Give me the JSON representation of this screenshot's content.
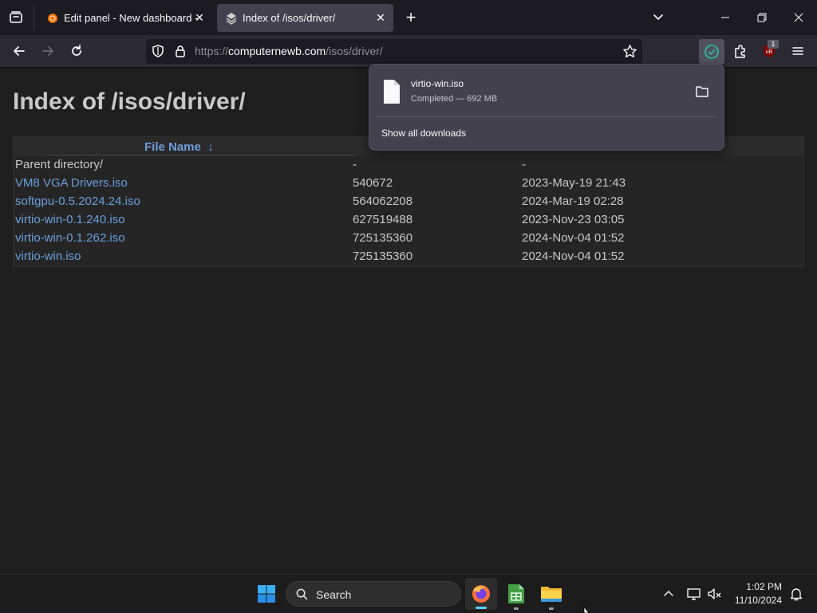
{
  "browser": {
    "tabs": [
      {
        "title": "Edit panel - New dashboard - D",
        "active": false
      },
      {
        "title": "Index of /isos/driver/",
        "active": true
      }
    ],
    "url": {
      "host_prefix": "https://",
      "host": "computernewb.com",
      "path": "/isos/driver/"
    },
    "badge_count": "1",
    "colors": {
      "accent": "#2ac3a2",
      "link": "#6a9fdc",
      "toolbar": "#2b2a33"
    }
  },
  "page": {
    "title": "Index of /isos/driver/",
    "header": {
      "file_name": "File Name",
      "sort_indicator": "↓"
    },
    "rows": [
      {
        "name": "Parent directory/",
        "size": "-",
        "date": "-",
        "link": false
      },
      {
        "name": "VM8 VGA Drivers.iso",
        "size": "540672",
        "date": "2023-May-19 21:43",
        "link": true
      },
      {
        "name": "softgpu-0.5.2024.24.iso",
        "size": "564062208",
        "date": "2024-Mar-19 02:28",
        "link": true
      },
      {
        "name": "virtio-win-0.1.240.iso",
        "size": "627519488",
        "date": "2023-Nov-23 03:05",
        "link": true
      },
      {
        "name": "virtio-win-0.1.262.iso",
        "size": "725135360",
        "date": "2024-Nov-04 01:52",
        "link": true
      },
      {
        "name": "virtio-win.iso",
        "size": "725135360",
        "date": "2024-Nov-04 01:52",
        "link": true
      }
    ]
  },
  "downloads": {
    "file_name": "virtio-win.iso",
    "status": "Completed — 692 MB",
    "show_all": "Show all downloads"
  },
  "taskbar": {
    "search_label": "Search",
    "time": "1:02 PM",
    "date": "11/10/2024"
  }
}
